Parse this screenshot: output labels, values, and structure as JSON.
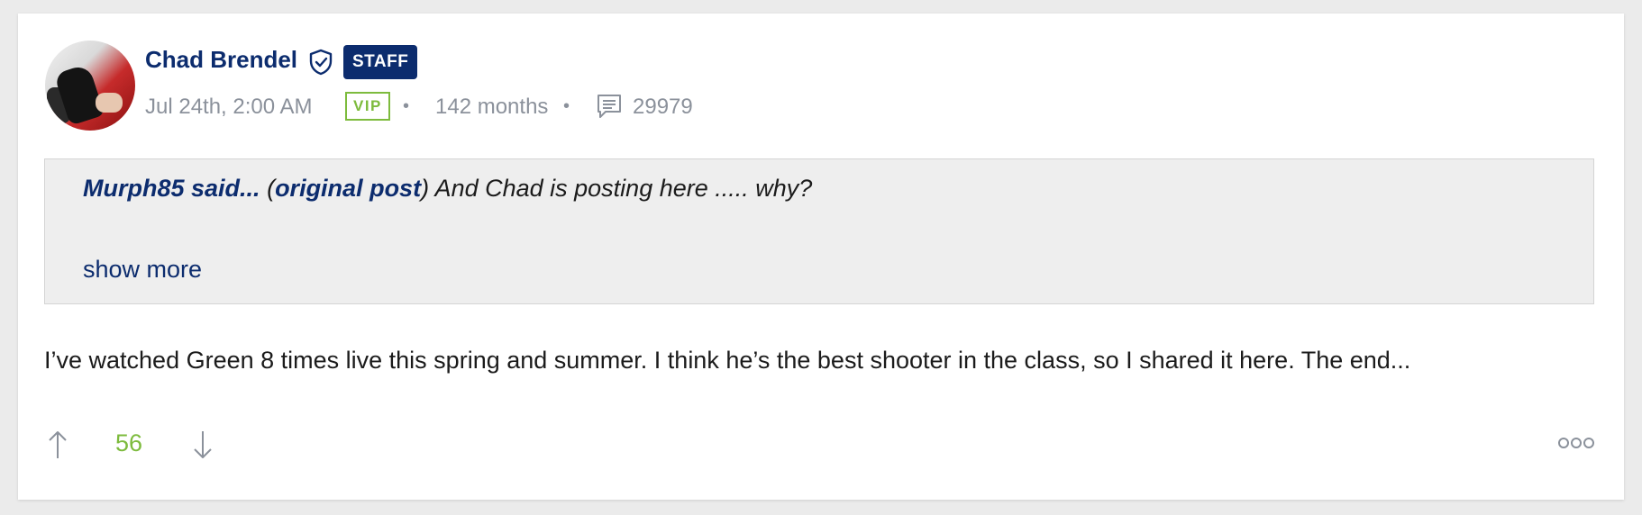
{
  "post": {
    "author": {
      "name": "Chad Brendel",
      "role_badge": "STAFF",
      "avatar_icon": "user-avatar"
    },
    "timestamp": "Jul 24th, 2:00 AM",
    "membership_badge": "VIP",
    "separator": "•",
    "membership_duration": "142 months",
    "post_count": "29979",
    "quote": {
      "author": "Murph85 said...",
      "link_open": "(",
      "link_label": "original post",
      "link_close": ")",
      "text": " And Chad is posting here ..... why?",
      "show_more_label": "show more"
    },
    "body": "I’ve watched Green 8 times live this spring and summer. I think he’s the best shooter in the class, so I shared it here. The end...",
    "votes": {
      "score": "56"
    }
  },
  "colors": {
    "brand_navy": "#0c2c6e",
    "vip_green": "#7dbb3d",
    "muted_gray": "#8b919b",
    "quote_background": "#eeeeee"
  }
}
